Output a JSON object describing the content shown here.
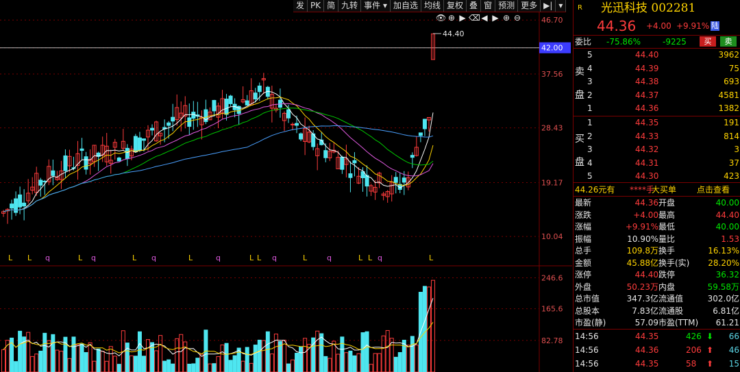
{
  "toolbar": [
    "发",
    "PK",
    "简",
    "九转",
    "事件 ▾",
    "加自选",
    "均线",
    "复权",
    "叠",
    "窗",
    "预测",
    "更多",
    "▶|",
    "▾"
  ],
  "controls": {
    "eye": "👁",
    "zoom_in": "⊕",
    "play": "▶",
    "clear": "⌫",
    "prev": "◀",
    "next": "▶",
    "plus": "⊕",
    "minus": "⊖"
  },
  "price_axis": [
    "46.70",
    "42.00",
    "37.56",
    "28.43",
    "19.17",
    "10.04"
  ],
  "volume_axis": [
    "246.6",
    "165.6",
    "82.78"
  ],
  "max_price_label": "44.40",
  "markers": [
    "L",
    "L",
    "q",
    "L",
    "q",
    "L",
    "q",
    "L",
    "q",
    "L",
    "L",
    "q",
    "L",
    "q",
    "L",
    "L",
    "q",
    "L"
  ],
  "quote": {
    "badge": "R",
    "name": "光迅科技 002281",
    "price": "44.36",
    "change": "+4.00",
    "pct": "+9.91%",
    "lu": "陆",
    "weibi_label": "委比",
    "weibi": "-75.86%",
    "weicha": "-9225",
    "buy_btn": "买",
    "sell_btn": "卖"
  },
  "sell_label": [
    "卖",
    "盘"
  ],
  "buy_label": [
    "买",
    "盘"
  ],
  "asks": [
    {
      "lv": "5",
      "price": "44.40",
      "vol": "3962"
    },
    {
      "lv": "4",
      "price": "44.39",
      "vol": "75"
    },
    {
      "lv": "3",
      "price": "44.38",
      "vol": "693"
    },
    {
      "lv": "2",
      "price": "44.37",
      "vol": "4581"
    },
    {
      "lv": "1",
      "price": "44.36",
      "vol": "1382"
    }
  ],
  "bids": [
    {
      "lv": "1",
      "price": "44.35",
      "vol": "191"
    },
    {
      "lv": "2",
      "price": "44.33",
      "vol": "814"
    },
    {
      "lv": "3",
      "price": "44.32",
      "vol": "3"
    },
    {
      "lv": "4",
      "price": "44.31",
      "vol": "37"
    },
    {
      "lv": "5",
      "price": "44.30",
      "vol": "423"
    }
  ],
  "bigorder": {
    "price": "44.26元有",
    "stars": "****手",
    "label": "大买单",
    "link": "点击查看"
  },
  "stats": [
    {
      "l1": "最新",
      "v1": "44.36",
      "c1": "red",
      "l2": "开盘",
      "v2": "40.00",
      "c2": "green"
    },
    {
      "l1": "涨跌",
      "v1": "+4.00",
      "c1": "red",
      "l2": "最高",
      "v2": "44.40",
      "c2": "red"
    },
    {
      "l1": "涨幅",
      "v1": "+9.91%",
      "c1": "red",
      "l2": "最低",
      "v2": "40.00",
      "c2": "green"
    },
    {
      "l1": "振幅",
      "v1": "10.90%",
      "c1": "white",
      "l2": "量比",
      "v2": "1.53",
      "c2": "red"
    },
    {
      "l1": "总手",
      "v1": "109.8万",
      "c1": "yellow",
      "l2": "换手",
      "v2": "16.13%",
      "c2": "yellow"
    },
    {
      "l1": "金额",
      "v1": "45.88亿",
      "c1": "yellow",
      "l2": "换手(实)",
      "v2": "28.20%",
      "c2": "yellow"
    },
    {
      "l1": "涨停",
      "v1": "44.40",
      "c1": "red",
      "l2": "跌停",
      "v2": "36.32",
      "c2": "green"
    },
    {
      "l1": "外盘",
      "v1": "50.23万",
      "c1": "red",
      "l2": "内盘",
      "v2": "59.58万",
      "c2": "green"
    },
    {
      "l1": "总市值",
      "v1": "347.3亿",
      "c1": "white",
      "l2": "流通值",
      "v2": "302.0亿",
      "c2": "white"
    },
    {
      "l1": "总股本",
      "v1": "7.83亿",
      "c1": "white",
      "l2": "流通股",
      "v2": "6.81亿",
      "c2": "white"
    },
    {
      "l1": "市盈(静)",
      "v1": "57.09",
      "c1": "white",
      "l2": "市盈(TTM)",
      "v2": "61.21",
      "c2": "white"
    }
  ],
  "ticks": [
    {
      "time": "14:56",
      "price": "44.35",
      "vol": "426",
      "dir": "down",
      "n": "66"
    },
    {
      "time": "14:56",
      "price": "44.36",
      "vol": "206",
      "dir": "up",
      "n": "46"
    },
    {
      "time": "14:56",
      "price": "44.35",
      "vol": "58",
      "dir": "up",
      "n": "15"
    }
  ],
  "colors": {
    "up": "#ff3c3c",
    "down": "#4ee6f0",
    "ma5": "#ffffff",
    "ma10": "#ffd400",
    "ma20": "#e05ae0",
    "ma30": "#00c800",
    "ma60": "#4aa0ff",
    "grid": "#7a0000"
  },
  "chart_data": {
    "type": "candlestick",
    "price_range": [
      6.0,
      48.0
    ],
    "volume_range": [
      0,
      260
    ],
    "last": {
      "open": 40.0,
      "high": 44.4,
      "low": 40.0,
      "close": 44.36
    }
  }
}
